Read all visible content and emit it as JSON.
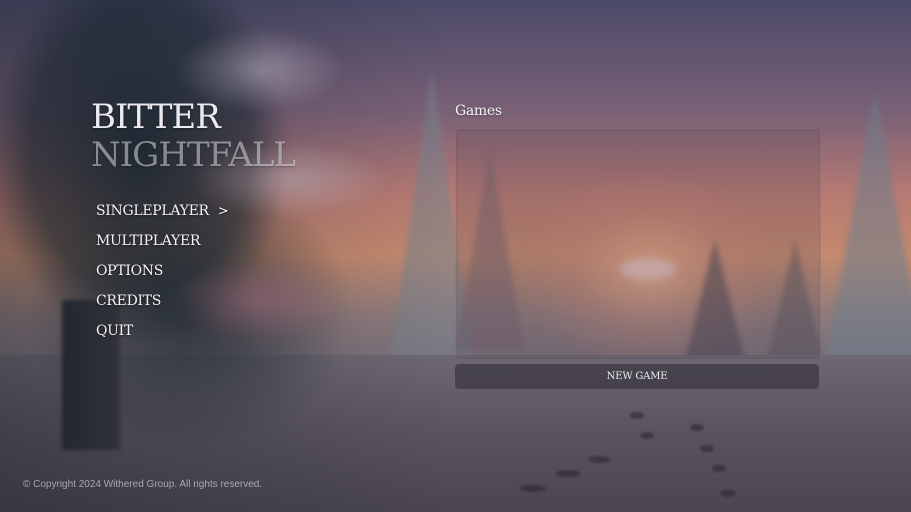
{
  "game": {
    "title_line1": "BITTER",
    "title_line2": "NIGHTFALL"
  },
  "menu": {
    "items": [
      {
        "label": "SINGLEPLAYER",
        "arrow": ">"
      },
      {
        "label": "MULTIPLAYER"
      },
      {
        "label": "OPTIONS"
      },
      {
        "label": "CREDITS"
      },
      {
        "label": "QUIT"
      }
    ]
  },
  "games_panel": {
    "label": "Games",
    "new_game_label": "NEW GAME"
  },
  "footer": {
    "copyright": "© Copyright 2024 Withered Group. All rights reserved."
  }
}
